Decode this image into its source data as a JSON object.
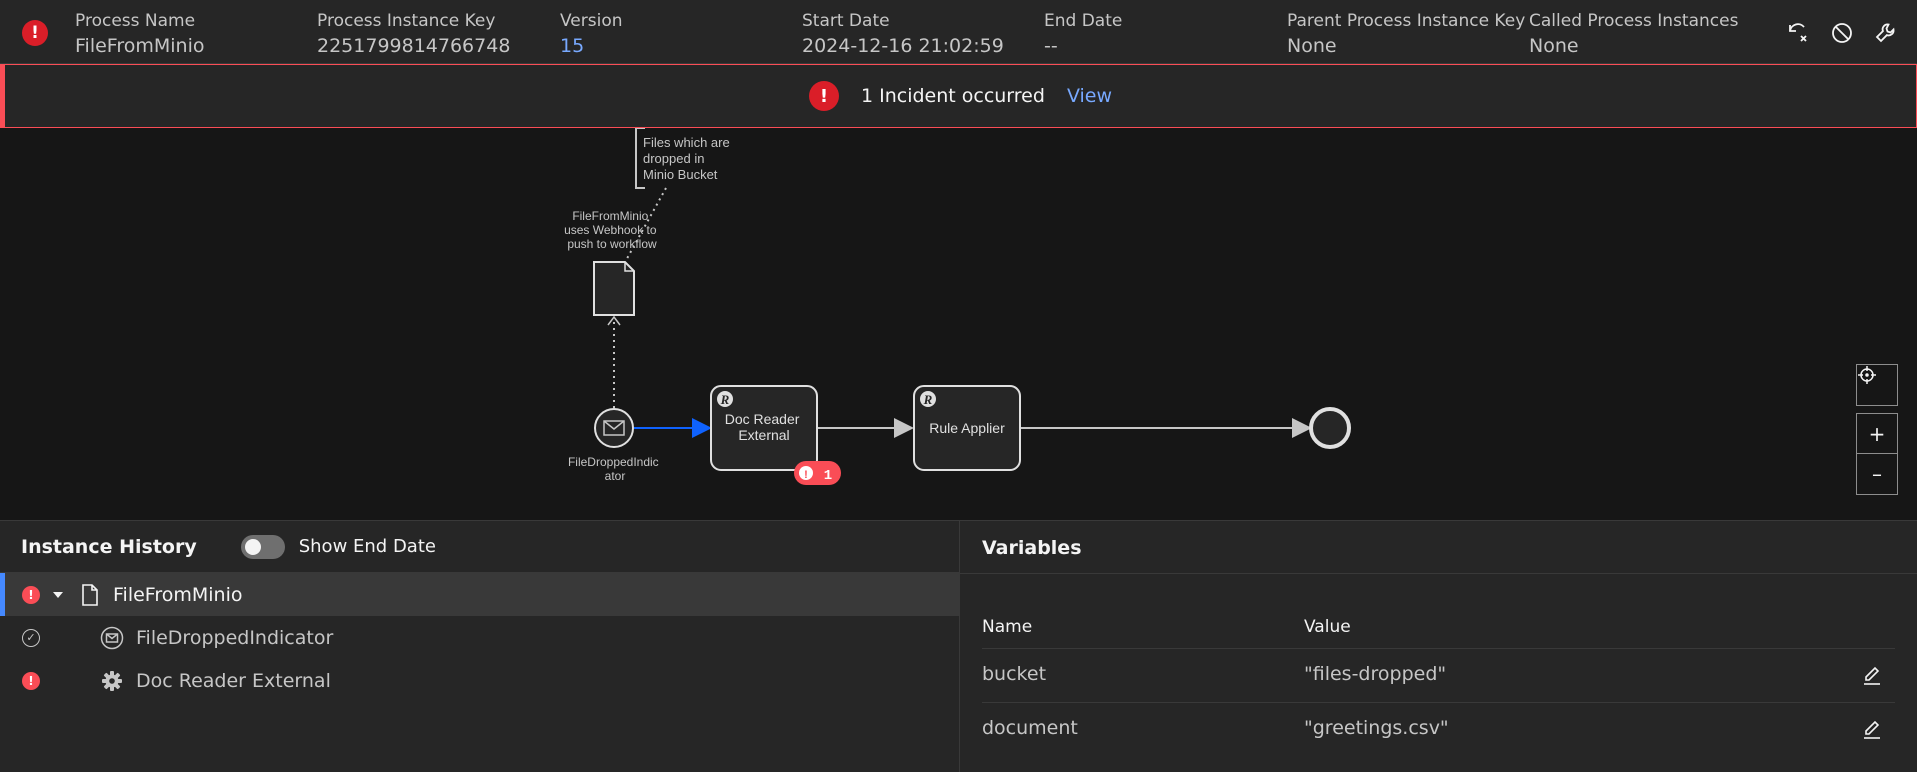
{
  "header": {
    "fields": [
      {
        "label": "Process Name",
        "value": "FileFromMinio"
      },
      {
        "label": "Process Instance Key",
        "value": "2251799814766748"
      },
      {
        "label": "Version",
        "value": "15"
      },
      {
        "label": "Start Date",
        "value": "2024-12-16 21:02:59"
      },
      {
        "label": "End Date",
        "value": "--"
      },
      {
        "label": "Parent Process Instance Key",
        "value": "None"
      },
      {
        "label": "Called Process Instances",
        "value": "None"
      }
    ],
    "state_icon": "incident-icon",
    "actions": [
      "retry-icon",
      "cancel-icon",
      "modify-icon"
    ]
  },
  "banner": {
    "text": "1 Incident occurred",
    "link": "View"
  },
  "diagram": {
    "annotation_text": [
      "Files which are",
      "dropped in",
      "Minio Bucket"
    ],
    "data_object_label": [
      "FileFromMinio",
      "uses Webhook to",
      "push to workflow"
    ],
    "start_event_label": [
      "FileDroppedIndic",
      "ator"
    ],
    "task1": {
      "marker": "R",
      "label": [
        "Doc Reader",
        "External"
      ],
      "incident_count": "1"
    },
    "task2": {
      "marker": "R",
      "label": [
        "Rule Applier"
      ]
    },
    "zoom": {
      "reset": "⌖",
      "in": "+",
      "out": "–"
    }
  },
  "history": {
    "title": "Instance History",
    "toggle_label": "Show End Date",
    "rows": [
      {
        "name": "FileFromMinio",
        "state": "incident",
        "icon": "document-icon"
      },
      {
        "name": "FileDroppedIndicator",
        "state": "completed",
        "icon": "message-icon"
      },
      {
        "name": "Doc Reader External",
        "state": "incident",
        "icon": "gear-icon"
      }
    ]
  },
  "variables": {
    "title": "Variables",
    "columns": {
      "name": "Name",
      "value": "Value"
    },
    "rows": [
      {
        "name": "bucket",
        "value": "\"files-dropped\""
      },
      {
        "name": "document",
        "value": "\"greetings.csv\""
      }
    ]
  },
  "colors": {
    "incident": "#da1e28",
    "link": "#78a9ff",
    "flow_active": "#0f62fe",
    "selected": "#4589ff"
  }
}
